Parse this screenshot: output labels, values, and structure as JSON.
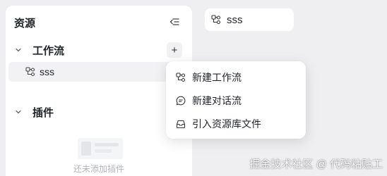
{
  "panel": {
    "title": "资源",
    "collapse_icon": "collapse-left-icon"
  },
  "sections": {
    "workflow": {
      "label": "工作流",
      "add_label": "+",
      "items": [
        {
          "label": "sss",
          "icon": "workflow-icon"
        }
      ]
    },
    "plugins": {
      "label": "插件",
      "empty_text": "还未添加插件"
    }
  },
  "tab": {
    "label": "sss",
    "icon": "workflow-icon"
  },
  "menu": {
    "items": [
      {
        "label": "新建工作流",
        "icon": "workflow-icon"
      },
      {
        "label": "新建对话流",
        "icon": "chat-flow-icon"
      },
      {
        "label": "引入资源库文件",
        "icon": "inbox-icon"
      }
    ]
  },
  "watermark": "掘金技术社区 @ 代码粘贴工"
}
